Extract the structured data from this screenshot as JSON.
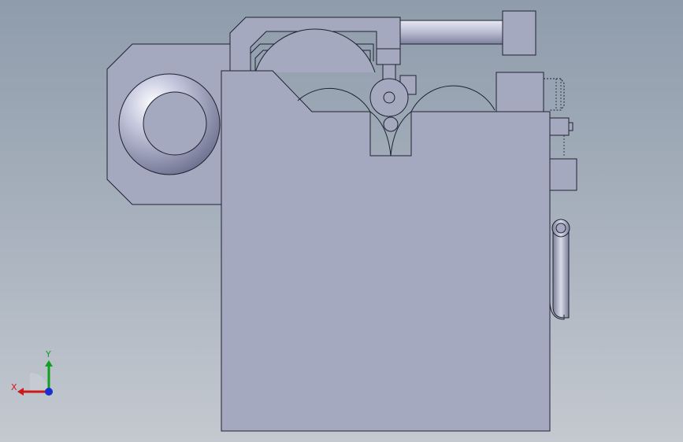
{
  "viewport": {
    "background_top": "#8f9cab",
    "background_bottom": "#c4c9d0",
    "part_fill": "#a4a9c0",
    "part_edge": "#1f2230"
  },
  "triad": {
    "x_label": "X",
    "y_label": "Y",
    "x_color": "#d01818",
    "y_color": "#10a020",
    "z_color": "#1830d0"
  }
}
